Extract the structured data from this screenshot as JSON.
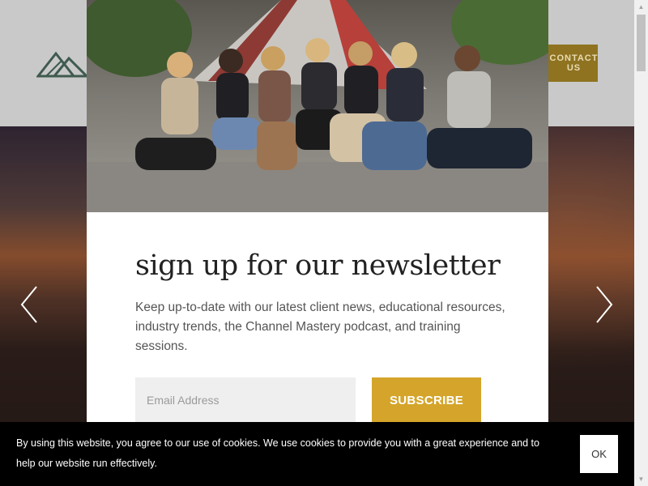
{
  "header": {
    "contact_label": "CONTACT US"
  },
  "modal": {
    "photo_alt": "Team of seven people sitting on the floor in front of a tent",
    "headline": "sign up for our newsletter",
    "description": "Keep up-to-date with our latest client news, educational resources, industry trends, the Channel Mastery podcast, and training sessions.",
    "email_placeholder": "Email Address",
    "subscribe_label": "SUBSCRIBE"
  },
  "cookie": {
    "text": "By using this website, you agree to our use of cookies. We use cookies to provide you with a great experience and to help our website run effectively.",
    "ok_label": "OK"
  },
  "colors": {
    "accent": "#d4a52a",
    "logo_green": "#3f5a4f",
    "cookie_bg": "#000000"
  }
}
